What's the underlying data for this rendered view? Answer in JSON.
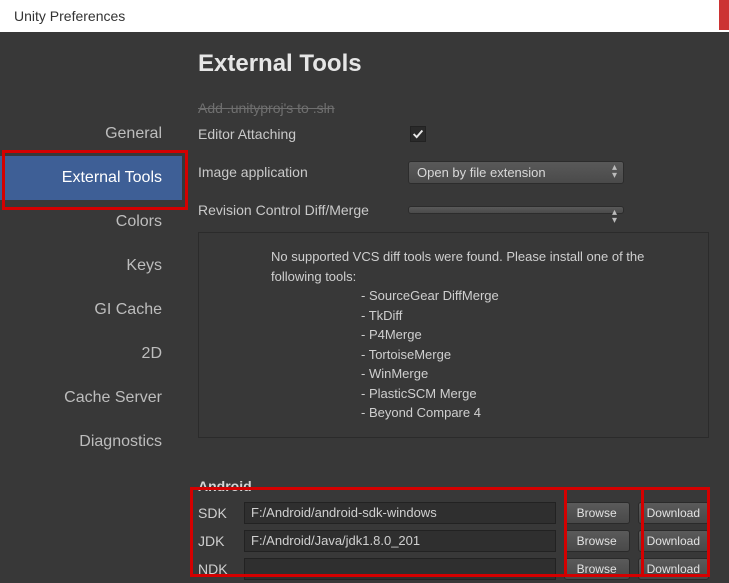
{
  "window": {
    "title": "Unity Preferences"
  },
  "sidebar": {
    "items": [
      {
        "label": "General"
      },
      {
        "label": "External Tools"
      },
      {
        "label": "Colors"
      },
      {
        "label": "Keys"
      },
      {
        "label": "GI Cache"
      },
      {
        "label": "2D"
      },
      {
        "label": "Cache Server"
      },
      {
        "label": "Diagnostics"
      }
    ],
    "selected_index": 1
  },
  "content": {
    "heading": "External Tools",
    "cutoff_row": "Add .unityproj's to .sln",
    "editor_attaching": {
      "label": "Editor Attaching",
      "checked": true
    },
    "image_app": {
      "label": "Image application",
      "value": "Open by file extension"
    },
    "revision_control": {
      "label": "Revision Control Diff/Merge",
      "value": ""
    },
    "vcs_message": {
      "line1": "No supported VCS diff tools were found. Please install one of the following tools:",
      "tools": [
        "- SourceGear DiffMerge",
        "- TkDiff",
        "- P4Merge",
        "- TortoiseMerge",
        "- WinMerge",
        "- PlasticSCM Merge",
        "- Beyond Compare 4"
      ]
    },
    "android": {
      "heading": "Android",
      "sdk": {
        "label": "SDK",
        "path": "F:/Android/android-sdk-windows"
      },
      "jdk": {
        "label": "JDK",
        "path": "F:/Android/Java/jdk1.8.0_201"
      },
      "ndk": {
        "label": "NDK",
        "path": ""
      },
      "browse_label": "Browse",
      "download_label": "Download"
    }
  }
}
